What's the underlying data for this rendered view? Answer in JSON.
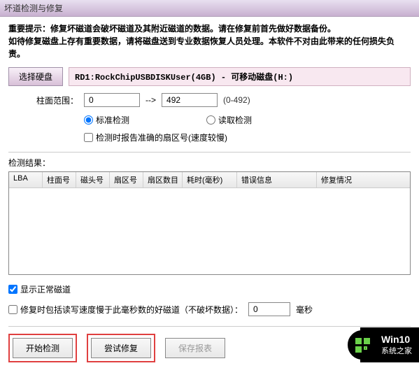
{
  "titlebar": {
    "title": "坏道检测与修复"
  },
  "warning": {
    "line1": "重要提示：修复坏磁道会破坏磁道及其附近磁道的数据。请在修复前首先做好数据备份。",
    "line2": "如待修复磁盘上存有重要数据，请将磁盘送到专业数据恢复人员处理。本软件不对由此带来的任何损失负责。"
  },
  "disk": {
    "select_btn": "选择硬盘",
    "path": "RD1:RockChipUSBDISKUser(4GB) - 可移动磁盘(H:)"
  },
  "cylinder": {
    "label": "柱面范围：",
    "start": "0",
    "arrow": "-->",
    "end": "492",
    "hint": "(0-492)"
  },
  "detect_mode": {
    "standard": "标准检测",
    "read_only": "读取检测"
  },
  "accurate_checkbox": {
    "label": "检测时报告准确的扇区号(速度较慢)"
  },
  "results": {
    "label": "检测结果：",
    "headers": {
      "lba": "LBA",
      "cylinder": "柱面号",
      "head": "磁头号",
      "sector": "扇区号",
      "sector_count": "扇区数目",
      "time": "耗时(毫秒)",
      "error": "错误信息",
      "fix_status": "修复情况"
    }
  },
  "show_normal": {
    "label": "显示正常磁道"
  },
  "repair_speed": {
    "label_before": "修复时包括读写速度慢于此毫秒数的好磁道（不破坏数据）：",
    "value": "0",
    "label_after": "毫秒"
  },
  "buttons": {
    "start": "开始检测",
    "repair": "尝试修复",
    "save": "保存报表"
  },
  "watermark": {
    "title": "Win10",
    "subtitle": "系统之家"
  }
}
